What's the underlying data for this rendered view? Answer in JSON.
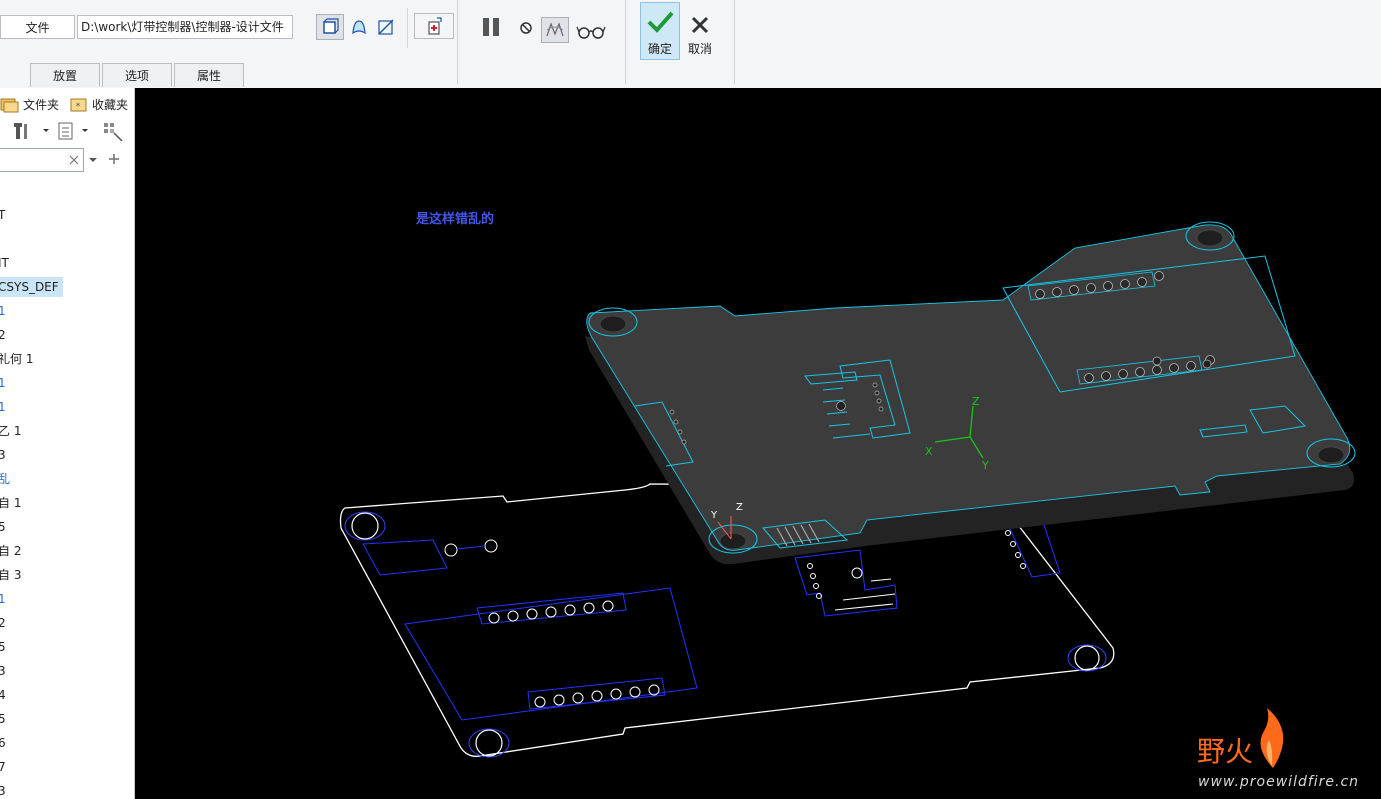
{
  "ribbon": {
    "file_label": "文件",
    "path_value": "D:\\work\\灯带控制器\\控制器-设计文件",
    "tabs": [
      "放置",
      "选项",
      "属性"
    ],
    "ok_label": "确定",
    "cancel_label": "取消"
  },
  "sidebar": {
    "tab_files": "文件夹",
    "tab_favorites": "收藏夹",
    "search_value": "",
    "items": [
      {
        "label": "T",
        "style": "normal"
      },
      {
        "label": "IT",
        "style": "normal"
      },
      {
        "label": "CSYS_DEF",
        "style": "selected"
      },
      {
        "label": "1",
        "style": "blue"
      },
      {
        "label": "2",
        "style": "normal"
      },
      {
        "label": "礼何 1",
        "style": "normal"
      },
      {
        "label": "1",
        "style": "blue"
      },
      {
        "label": "1",
        "style": "blue"
      },
      {
        "label": "乙 1",
        "style": "normal"
      },
      {
        "label": "3",
        "style": "normal"
      },
      {
        "label": "乱",
        "style": "blue"
      },
      {
        "label": "自 1",
        "style": "normal"
      },
      {
        "label": "5",
        "style": "normal"
      },
      {
        "label": "自 2",
        "style": "normal"
      },
      {
        "label": "自 3",
        "style": "normal"
      },
      {
        "label": "1",
        "style": "blue"
      },
      {
        "label": "2",
        "style": "normal"
      },
      {
        "label": "5",
        "style": "normal"
      },
      {
        "label": "3",
        "style": "normal"
      },
      {
        "label": "4",
        "style": "normal"
      },
      {
        "label": "5",
        "style": "normal"
      },
      {
        "label": "6",
        "style": "normal"
      },
      {
        "label": "7",
        "style": "normal"
      },
      {
        "label": "3",
        "style": "normal"
      }
    ]
  },
  "viewport": {
    "annotation": "是这样错乱的",
    "axis_labels": {
      "x": "X",
      "y": "Y",
      "z": "Z"
    },
    "watermark_cn": "野火",
    "watermark_url": "www.proewildfire.cn"
  },
  "colors": {
    "viewport_bg": "#000000",
    "board_fill": "#3a3a3a",
    "cyan_edge": "#17c6e8",
    "blue_outline": "#2233ff",
    "white_outline": "#ffffff",
    "accent_ok": "#cfe8f6",
    "watermark": "#ff6a1a"
  }
}
